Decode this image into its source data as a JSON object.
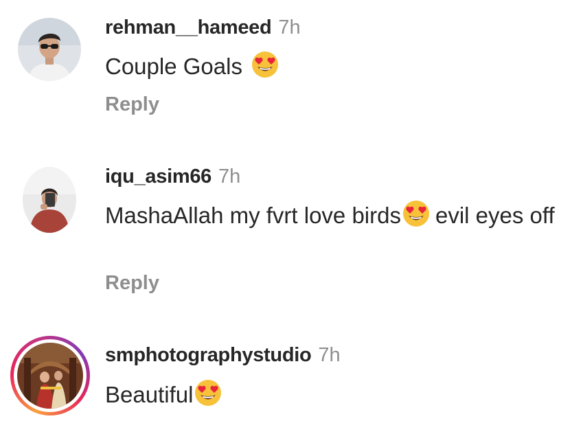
{
  "comments": [
    {
      "username": "rehman__hameed",
      "time": "7h",
      "text_parts": [
        "Couple Goals "
      ],
      "emoji": "heart-eyes",
      "reply_label": "Reply"
    },
    {
      "username": "iqu_asim66",
      "time": "7h",
      "text_parts": [
        "MashaAllah my fvrt love birds",
        "evil eyes off"
      ],
      "emoji": "heart-eyes",
      "reply_label": "Reply"
    },
    {
      "username": "smphotographystudio",
      "time": "7h",
      "text_parts": [
        "Beautiful"
      ],
      "emoji": "heart-eyes",
      "story_ring": true
    }
  ],
  "colors": {
    "text": "#262626",
    "muted": "#8e8e8e",
    "emoji_face": "#f7c23a",
    "emoji_heart": "#e8243c"
  }
}
